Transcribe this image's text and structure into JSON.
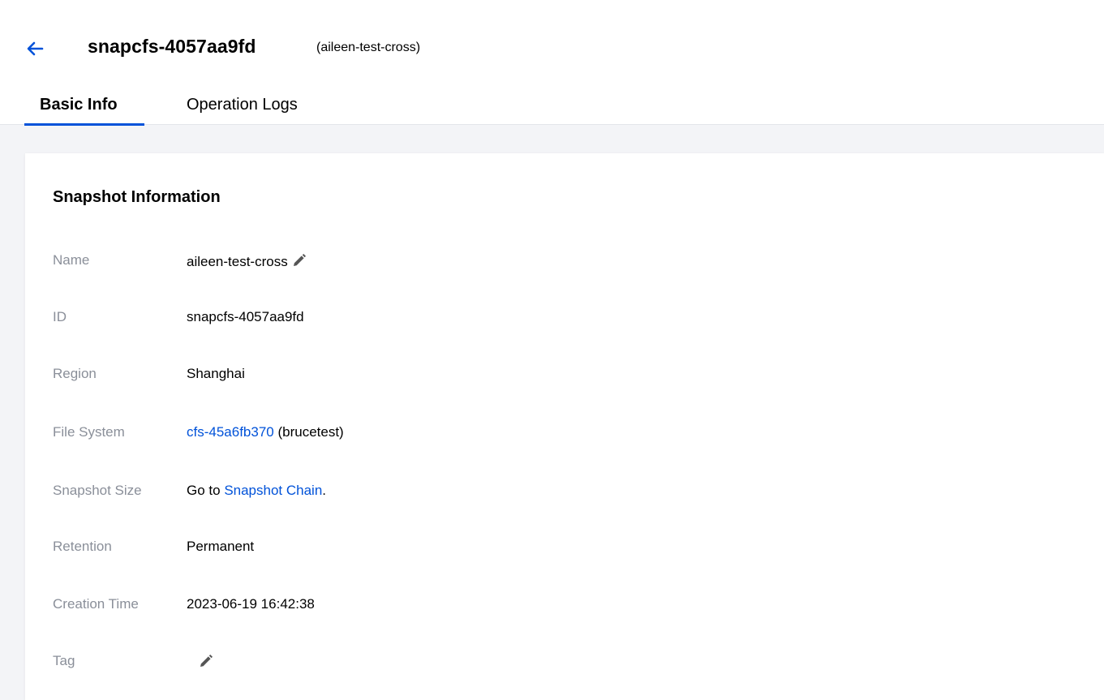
{
  "header": {
    "title": "snapcfs-4057aa9fd",
    "subtitle": "(aileen-test-cross)"
  },
  "tabs": [
    {
      "label": "Basic Info",
      "active": true
    },
    {
      "label": "Operation Logs",
      "active": false
    }
  ],
  "panel": {
    "title": "Snapshot Information",
    "rows": {
      "name": {
        "label": "Name",
        "value": "aileen-test-cross"
      },
      "id": {
        "label": "ID",
        "value": "snapcfs-4057aa9fd"
      },
      "region": {
        "label": "Region",
        "value": "Shanghai"
      },
      "file_system": {
        "label": "File System",
        "link": "cfs-45a6fb370",
        "suffix": " (brucetest)"
      },
      "snapshot_size": {
        "label": "Snapshot Size",
        "prefix": "Go to ",
        "link": "Snapshot Chain",
        "suffix": "."
      },
      "retention": {
        "label": "Retention",
        "value": "Permanent"
      },
      "creation_time": {
        "label": "Creation Time",
        "value": "2023-06-19 16:42:38"
      },
      "tag": {
        "label": "Tag",
        "value": ""
      }
    }
  },
  "icons": {
    "back": "arrow-left-icon",
    "edit": "pencil-icon"
  },
  "colors": {
    "accent": "#0052d9",
    "label": "#8a8f99",
    "background": "#f3f4f7"
  }
}
